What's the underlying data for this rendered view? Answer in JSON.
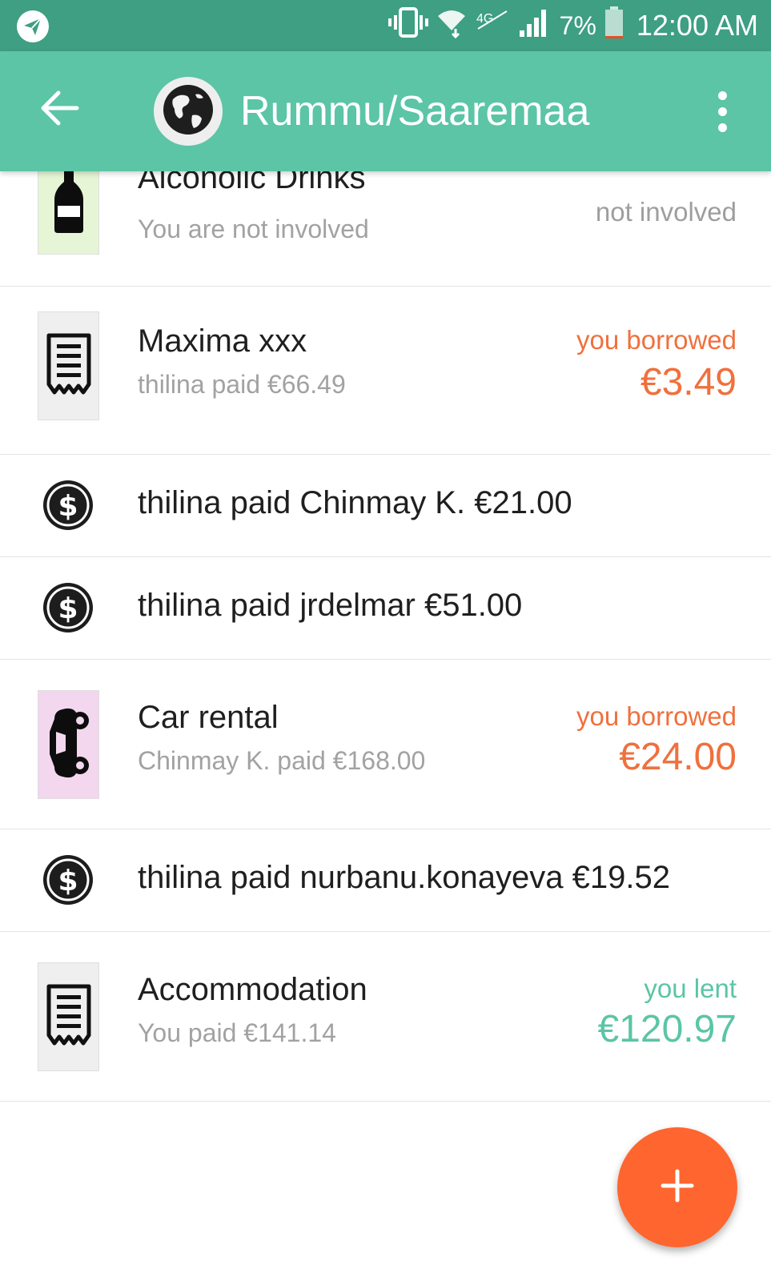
{
  "status_bar": {
    "battery": "7%",
    "time": "12:00 AM",
    "icons": [
      "telegram-icon",
      "vibrate-icon",
      "wifi-icon",
      "4g-icon",
      "signal-icon",
      "battery-icon"
    ]
  },
  "app_bar": {
    "title": "Rummu/Saaremaa",
    "back_icon": "arrow-back-icon",
    "avatar_icon": "globe-icon",
    "menu_icon": "more-vert-icon"
  },
  "colors": {
    "status_bar": "#3e9f82",
    "app_bar": "#5bc5a6",
    "borrowed": "#f0703d",
    "lent": "#5bc5a6",
    "fab": "#ff652f",
    "drinks_icon_bg": "#e6f5d6",
    "car_icon_bg": "#f3d7ee",
    "receipt_icon_bg": "#efefef"
  },
  "expenses": [
    {
      "title": "Alconolic Drinks",
      "subtitle": "You are not involved",
      "status": "not involved",
      "amount": "",
      "icon": "wine-bottle-icon"
    },
    {
      "title": "Maxima xxx",
      "subtitle": "thilina paid €66.49",
      "status": "you borrowed",
      "amount": "€3.49",
      "icon": "receipt-icon"
    },
    {
      "payment": "thilina paid Chinmay K. €21.00",
      "icon": "dollar-circle-icon"
    },
    {
      "payment": "thilina paid jrdelmar €51.00",
      "icon": "dollar-circle-icon"
    },
    {
      "title": "Car rental",
      "subtitle": "Chinmay K. paid €168.00",
      "status": "you borrowed",
      "amount": "€24.00",
      "icon": "car-icon"
    },
    {
      "payment": "thilina paid nurbanu.konayeva €19.52",
      "icon": "dollar-circle-icon"
    },
    {
      "title": "Accommodation",
      "subtitle": "You paid €141.14",
      "status": "you lent",
      "amount": "€120.97",
      "icon": "receipt-icon"
    }
  ],
  "fab": {
    "icon": "plus-icon"
  }
}
